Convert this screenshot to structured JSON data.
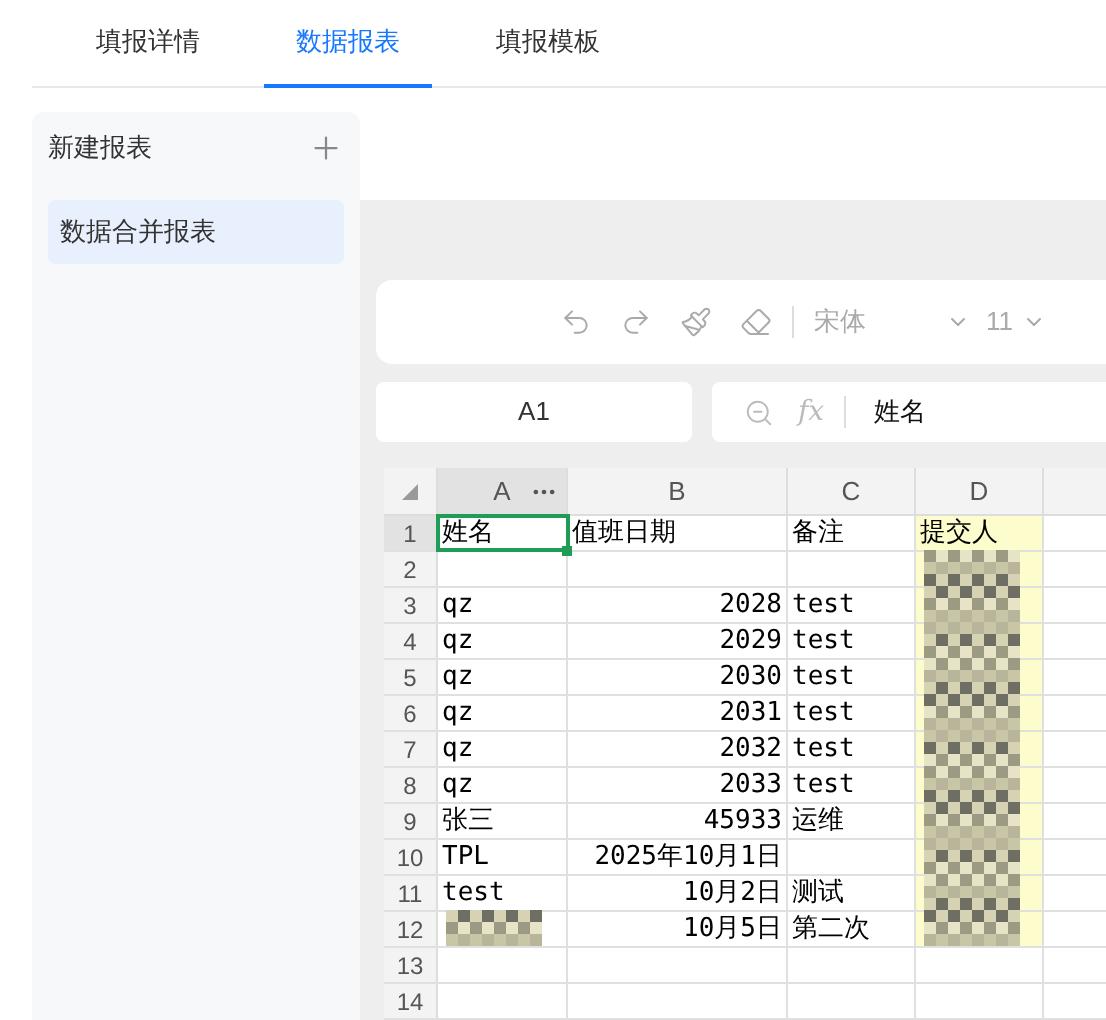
{
  "tabs": [
    {
      "label": "填报详情",
      "selected": false
    },
    {
      "label": "数据报表",
      "selected": true
    },
    {
      "label": "填报模板",
      "selected": false
    }
  ],
  "sidebar": {
    "title": "新建报表",
    "items": [
      {
        "label": "数据合并报表",
        "selected": true
      }
    ]
  },
  "toolbar": {
    "font": "宋体",
    "font_size": "11"
  },
  "name_box": "A1",
  "formula_bar": {
    "fx": "fx",
    "value": "姓名"
  },
  "sheet": {
    "columns": [
      {
        "label": "A",
        "selected": true,
        "highlighted": false
      },
      {
        "label": "B",
        "selected": false,
        "highlighted": false
      },
      {
        "label": "C",
        "selected": false,
        "highlighted": false
      },
      {
        "label": "D",
        "selected": false,
        "highlighted": true
      }
    ],
    "rows": [
      {
        "number": "1",
        "selected": true,
        "a": {
          "text": "姓名"
        },
        "b": {
          "text": "值班日期"
        },
        "c": {
          "text": "备注"
        },
        "d": {
          "text": "提交人"
        }
      },
      {
        "number": "2",
        "selected": false,
        "d": {
          "redacted": true
        }
      },
      {
        "number": "3",
        "selected": false,
        "a": {
          "text": "qz"
        },
        "b": {
          "text": "2028",
          "kind": "number"
        },
        "c": {
          "text": "test"
        },
        "d": {
          "redacted": true
        }
      },
      {
        "number": "4",
        "selected": false,
        "a": {
          "text": "qz"
        },
        "b": {
          "text": "2029",
          "kind": "number"
        },
        "c": {
          "text": "test"
        },
        "d": {
          "redacted": true
        }
      },
      {
        "number": "5",
        "selected": false,
        "a": {
          "text": "qz"
        },
        "b": {
          "text": "2030",
          "kind": "number"
        },
        "c": {
          "text": "test"
        },
        "d": {
          "redacted": true
        }
      },
      {
        "number": "6",
        "selected": false,
        "a": {
          "text": "qz"
        },
        "b": {
          "text": "2031",
          "kind": "number"
        },
        "c": {
          "text": "test"
        },
        "d": {
          "redacted": true
        }
      },
      {
        "number": "7",
        "selected": false,
        "a": {
          "text": "qz"
        },
        "b": {
          "text": "2032",
          "kind": "number"
        },
        "c": {
          "text": "test"
        },
        "d": {
          "redacted": true
        }
      },
      {
        "number": "8",
        "selected": false,
        "a": {
          "text": "qz"
        },
        "b": {
          "text": "2033",
          "kind": "number"
        },
        "c": {
          "text": "test"
        },
        "d": {
          "redacted": true
        }
      },
      {
        "number": "9",
        "selected": false,
        "a": {
          "text": "张三"
        },
        "b": {
          "text": "45933",
          "kind": "number"
        },
        "c": {
          "text": "运维"
        },
        "d": {
          "redacted": true
        }
      },
      {
        "number": "10",
        "selected": false,
        "a": {
          "text": "TPL"
        },
        "b": {
          "text": "2025年10月1日",
          "kind": "number"
        },
        "d": {
          "redacted": true
        }
      },
      {
        "number": "11",
        "selected": false,
        "a": {
          "text": "test"
        },
        "b": {
          "text": "10月2日",
          "kind": "number"
        },
        "c": {
          "text": "测试"
        },
        "d": {
          "redacted": true
        }
      },
      {
        "number": "12",
        "selected": false,
        "a": {
          "redacted": true
        },
        "b": {
          "text": "10月5日",
          "kind": "number"
        },
        "c": {
          "text": "第二次"
        },
        "d": {
          "redacted": true
        }
      },
      {
        "number": "13",
        "selected": false
      },
      {
        "number": "14",
        "selected": false
      }
    ]
  }
}
